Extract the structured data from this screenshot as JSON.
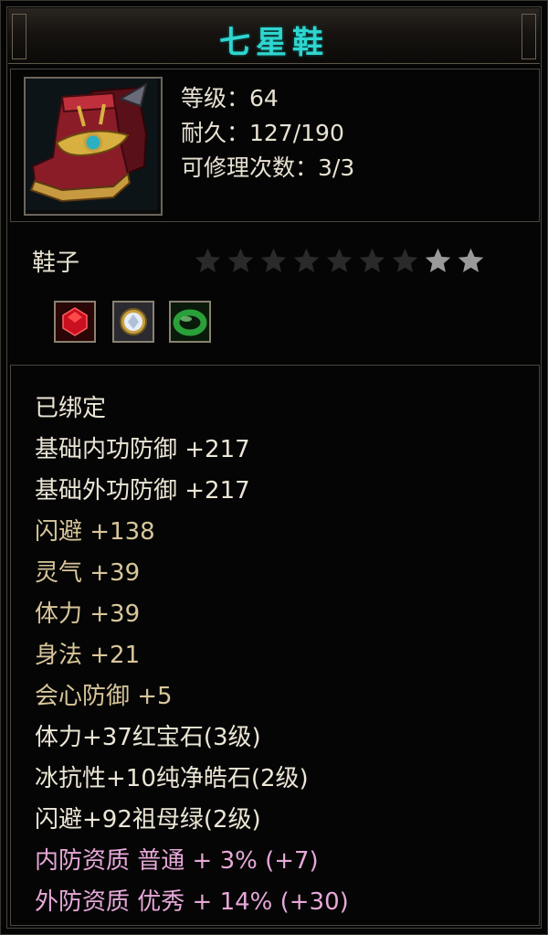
{
  "item": {
    "name": "七星鞋",
    "level_line": "等级：64",
    "durability_line": "耐久：127/190",
    "repair_line": "可修理次数：3/3",
    "type": "鞋子",
    "stars_total": 9,
    "stars_filled": 2
  },
  "gems": [
    {
      "name": "红宝石",
      "icon": "red-ruby-icon",
      "color": "#d01818"
    },
    {
      "name": "纯净皓石",
      "icon": "white-diamond-icon",
      "color": "#e8e8f0"
    },
    {
      "name": "祖母绿",
      "icon": "green-jade-ring-icon",
      "color": "#2aa03a"
    }
  ],
  "attributes": [
    {
      "text": "已绑定",
      "style": "white"
    },
    {
      "text": "基础内功防御 +217",
      "style": "white"
    },
    {
      "text": "基础外功防御 +217",
      "style": "white"
    },
    {
      "text": "闪避 +138",
      "style": "gold"
    },
    {
      "text": "灵气 +39",
      "style": "gold"
    },
    {
      "text": "体力 +39",
      "style": "gold"
    },
    {
      "text": "身法 +21",
      "style": "gold"
    },
    {
      "text": "会心防御 +5",
      "style": "gold"
    },
    {
      "text": "体力+37红宝石(3级)",
      "style": "white"
    },
    {
      "text": "冰抗性+10纯净皓石(2级)",
      "style": "white"
    },
    {
      "text": "闪避+92祖母绿(2级)",
      "style": "white"
    },
    {
      "text": "内防资质 普通 + 3% (+7)",
      "style": "pink"
    },
    {
      "text": "外防资质 优秀 + 14% (+30)",
      "style": "pink"
    }
  ],
  "colors": {
    "title": "#2fd6d0",
    "white_text": "#ece6d6",
    "gold_text": "#d8c69a",
    "pink_text": "#e6a8d8",
    "star_empty": "#2a2a2a",
    "star_filled": "#9a9a9a"
  }
}
